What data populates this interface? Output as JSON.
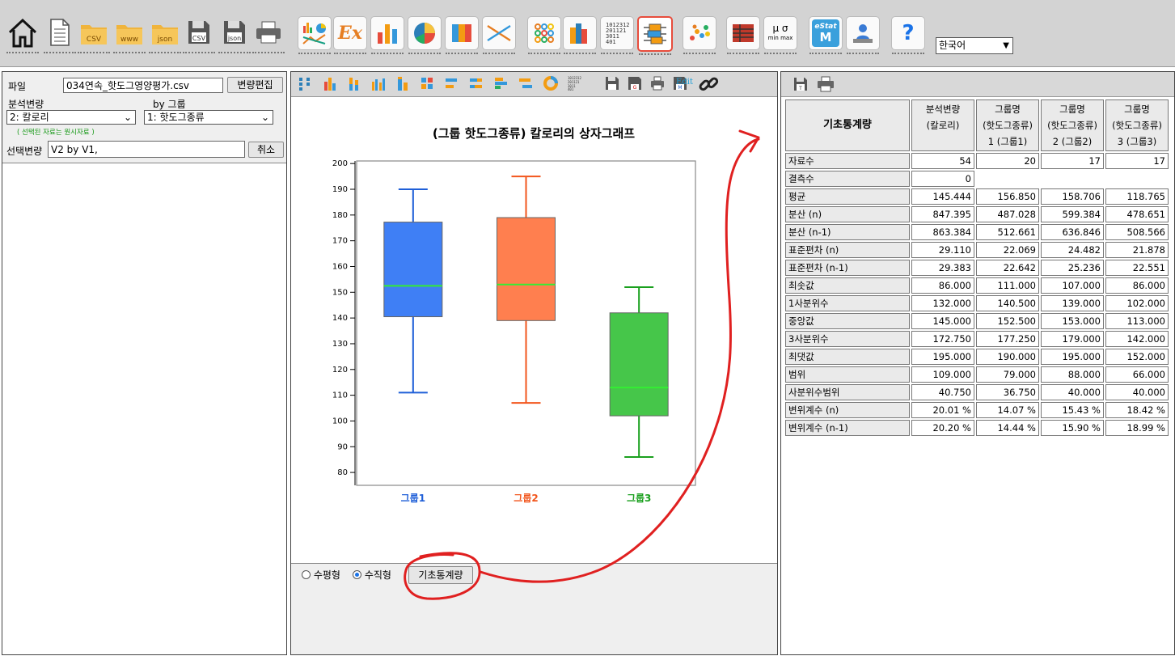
{
  "toolbar": {
    "language": "한국어",
    "csv_label": "CSV",
    "www_label": "www",
    "json_label": "json",
    "ex_label": "Ex",
    "estat_label": "eStat",
    "estat_m": "M",
    "mu_sigma": "μ σ",
    "min_max": "min max",
    "help": "?",
    "numbers_label": "1012312\n201121\n3011\n401"
  },
  "left": {
    "file_label": "파일",
    "file_name": "034연속_핫도그영양평가.csv",
    "edit_button": "변량편집",
    "analysis_var_label": "분석변량",
    "by_group_label": "by 그룹",
    "analysis_var_value": "2: 칼로리",
    "group_var_value": "1: 핫도그종류",
    "note": "( 선택된 자료는 원시자료 )",
    "selected_label": "선택변량",
    "selected_value": "V2  by  V1,",
    "cancel_button": "취소"
  },
  "middle": {
    "edit_label": "Edit",
    "horizontal_label": "수평형",
    "vertical_label": "수직형",
    "stats_button": "기초통계량"
  },
  "chart_data": {
    "type": "boxplot",
    "title": "(그룹 핫도그종류) 칼로리의 상자그래프",
    "ylim": [
      75,
      201
    ],
    "yticks": [
      80,
      90,
      100,
      110,
      120,
      130,
      140,
      150,
      160,
      170,
      180,
      190,
      200
    ],
    "series": [
      {
        "name": "그룹1",
        "min": 111,
        "q1": 140.5,
        "median": 152.5,
        "q3": 177.25,
        "max": 190,
        "color": "#3f7ff5",
        "stroke": "#1f5fd8",
        "label_color": "#1f5fd8"
      },
      {
        "name": "그룹2",
        "min": 107,
        "q1": 139,
        "median": 153,
        "q3": 179,
        "max": 195,
        "color": "#ff7f4f",
        "stroke": "#f2561d",
        "label_color": "#f2561d"
      },
      {
        "name": "그룹3",
        "min": 86,
        "q1": 102,
        "median": 113,
        "q3": 142,
        "max": 152,
        "color": "#46c64a",
        "stroke": "#1aa01e",
        "label_color": "#1aa01e"
      }
    ],
    "median_color": "#33ee33"
  },
  "stats": {
    "header_title": "기초통계량",
    "columns": [
      [
        "분석변량",
        "(칼로리)",
        ""
      ],
      [
        "그룹명",
        "(핫도그종류)",
        "1 (그룹1)"
      ],
      [
        "그룹명",
        "(핫도그종류)",
        "2 (그룹2)"
      ],
      [
        "그룹명",
        "(핫도그종류)",
        "3 (그룹3)"
      ]
    ],
    "rows": [
      {
        "name": "자료수",
        "values": [
          "54",
          "20",
          "17",
          "17"
        ]
      },
      {
        "name": "결측수",
        "values": [
          "0",
          "",
          "",
          ""
        ]
      },
      {
        "name": "평균",
        "values": [
          "145.444",
          "156.850",
          "158.706",
          "118.765"
        ]
      },
      {
        "name": "분산 (n)",
        "values": [
          "847.395",
          "487.028",
          "599.384",
          "478.651"
        ]
      },
      {
        "name": "분산 (n-1)",
        "values": [
          "863.384",
          "512.661",
          "636.846",
          "508.566"
        ]
      },
      {
        "name": "표준편차 (n)",
        "values": [
          "29.110",
          "22.069",
          "24.482",
          "21.878"
        ]
      },
      {
        "name": "표준편차 (n-1)",
        "values": [
          "29.383",
          "22.642",
          "25.236",
          "22.551"
        ]
      },
      {
        "name": "최솟값",
        "values": [
          "86.000",
          "111.000",
          "107.000",
          "86.000"
        ]
      },
      {
        "name": "1사분위수",
        "values": [
          "132.000",
          "140.500",
          "139.000",
          "102.000"
        ]
      },
      {
        "name": "중앙값",
        "values": [
          "145.000",
          "152.500",
          "153.000",
          "113.000"
        ]
      },
      {
        "name": "3사분위수",
        "values": [
          "172.750",
          "177.250",
          "179.000",
          "142.000"
        ]
      },
      {
        "name": "최댓값",
        "values": [
          "195.000",
          "190.000",
          "195.000",
          "152.000"
        ]
      },
      {
        "name": "범위",
        "values": [
          "109.000",
          "79.000",
          "88.000",
          "66.000"
        ]
      },
      {
        "name": "사분위수범위",
        "values": [
          "40.750",
          "36.750",
          "40.000",
          "40.000"
        ]
      },
      {
        "name": "변위계수 (n)",
        "values": [
          "20.01 %",
          "14.07 %",
          "15.43 %",
          "18.42 %"
        ]
      },
      {
        "name": "변위계수 (n-1)",
        "values": [
          "20.20 %",
          "14.44 %",
          "15.90 %",
          "18.99 %"
        ]
      }
    ]
  },
  "annotation": {
    "color": "#e02020"
  }
}
